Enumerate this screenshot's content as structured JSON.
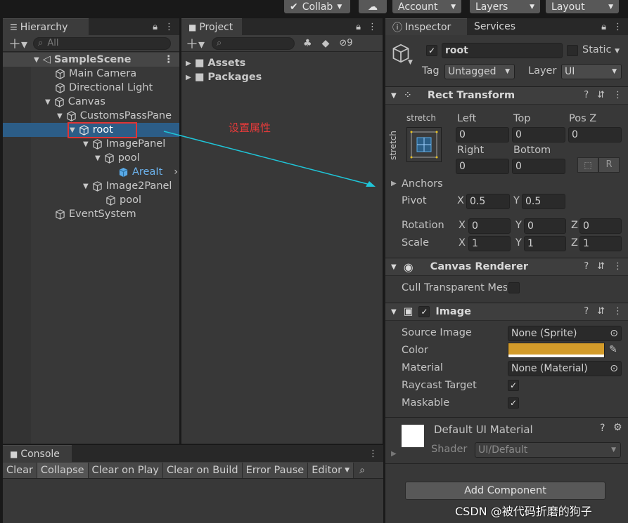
{
  "topbar": {
    "collab": "Collab",
    "account": "Account",
    "layers": "Layers",
    "layout": "Layout"
  },
  "hierarchy": {
    "tab": "Hierarchy",
    "search_placeholder": "All",
    "scene": "SampleScene",
    "items": [
      "Main Camera",
      "Directional Light",
      "Canvas",
      "CustomsPassPane",
      "root",
      "ImagePanel",
      "pool",
      "AreaIt",
      "Image2Panel",
      "pool",
      "EventSystem"
    ]
  },
  "project": {
    "tab": "Project",
    "hidden_count": "9",
    "folders": [
      "Assets",
      "Packages"
    ]
  },
  "annotation": {
    "text": "设置属性"
  },
  "inspector": {
    "tab": "Inspector",
    "tab2": "Services",
    "object_name": "root",
    "static_label": "Static",
    "tag_label": "Tag",
    "tag_value": "Untagged",
    "layer_label": "Layer",
    "layer_value": "UI",
    "rect_transform": {
      "title": "Rect Transform",
      "anchor_top": "stretch",
      "anchor_side": "stretch",
      "left_label": "Left",
      "top_label": "Top",
      "posz_label": "Pos Z",
      "left": "0",
      "top": "0",
      "posz": "0",
      "right_label": "Right",
      "bottom_label": "Bottom",
      "right": "0",
      "bottom": "0",
      "anchors_label": "Anchors",
      "pivot_label": "Pivot",
      "pivot_x": "0.5",
      "pivot_y": "0.5",
      "rotation_label": "Rotation",
      "rot_x": "0",
      "rot_y": "0",
      "rot_z": "0",
      "scale_label": "Scale",
      "scale_x": "1",
      "scale_y": "1",
      "scale_z": "1",
      "x": "X",
      "y": "Y",
      "z": "Z",
      "r": "R"
    },
    "canvas_renderer": {
      "title": "Canvas Renderer",
      "cull_label": "Cull Transparent Mes"
    },
    "image": {
      "title": "Image",
      "source_label": "Source Image",
      "source_value": "None (Sprite)",
      "color_label": "Color",
      "color_value": "#D39B2A",
      "material_label": "Material",
      "material_value": "None (Material)",
      "raycast_label": "Raycast Target",
      "maskable_label": "Maskable"
    },
    "material": {
      "name": "Default UI Material",
      "shader_label": "Shader",
      "shader_value": "UI/Default"
    },
    "add_component": "Add Component"
  },
  "console": {
    "tab": "Console",
    "buttons": [
      "Clear",
      "Collapse",
      "Clear on Play",
      "Clear on Build",
      "Error Pause",
      "Editor"
    ]
  },
  "watermark": "CSDN @被代码折磨的狗子"
}
